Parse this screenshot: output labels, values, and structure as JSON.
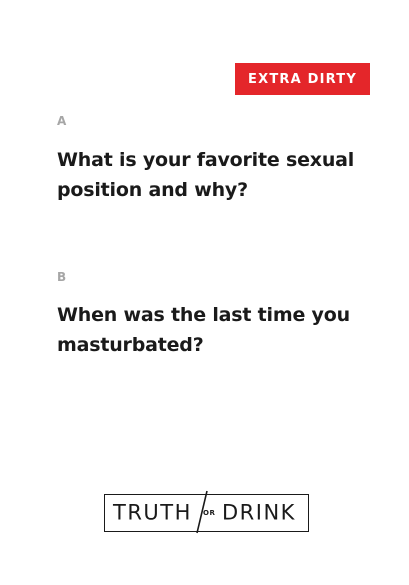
{
  "badge": {
    "label": "EXTRA DIRTY",
    "color": "#e4262a"
  },
  "questions": [
    {
      "letter": "A",
      "text": "What is your favorite sexual position and why?"
    },
    {
      "letter": "B",
      "text": "When was the last time you masturbated?"
    }
  ],
  "logo": {
    "left_word": "TRUTH",
    "connector": "OR",
    "right_word": "DRINK"
  }
}
